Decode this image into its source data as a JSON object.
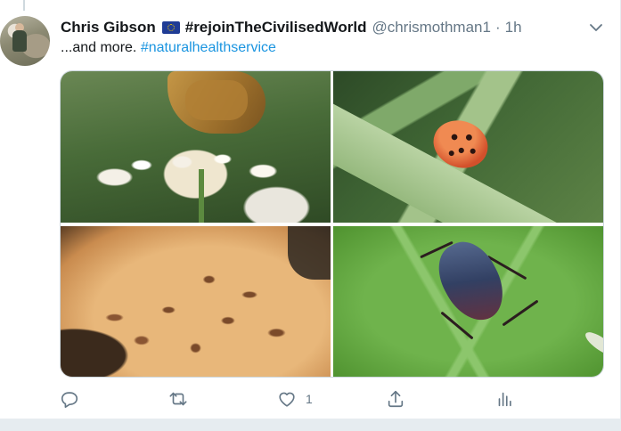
{
  "tweet": {
    "author_name": "Chris Gibson",
    "flag_icon": "eu-flag-icon",
    "display_suffix": "#rejoinTheCivilisedWorld",
    "handle": "@chrismothman1",
    "separator": "·",
    "time": "1h",
    "text_prefix": "...and more. ",
    "hashtag": "#naturalhealthservice"
  },
  "media": {
    "images": [
      {
        "subject": "butterfly-on-white-flowers"
      },
      {
        "subject": "ladybird-on-grass-blade"
      },
      {
        "subject": "bracket-fungus-underside"
      },
      {
        "subject": "bug-on-green-leaf"
      }
    ]
  },
  "actions": {
    "reply_icon": "reply-icon",
    "retweet_icon": "retweet-icon",
    "like_icon": "heart-icon",
    "like_count": "1",
    "share_icon": "share-icon",
    "analytics_icon": "analytics-icon"
  },
  "colors": {
    "link": "#1b95e0",
    "muted": "#657786",
    "text": "#14171a"
  }
}
